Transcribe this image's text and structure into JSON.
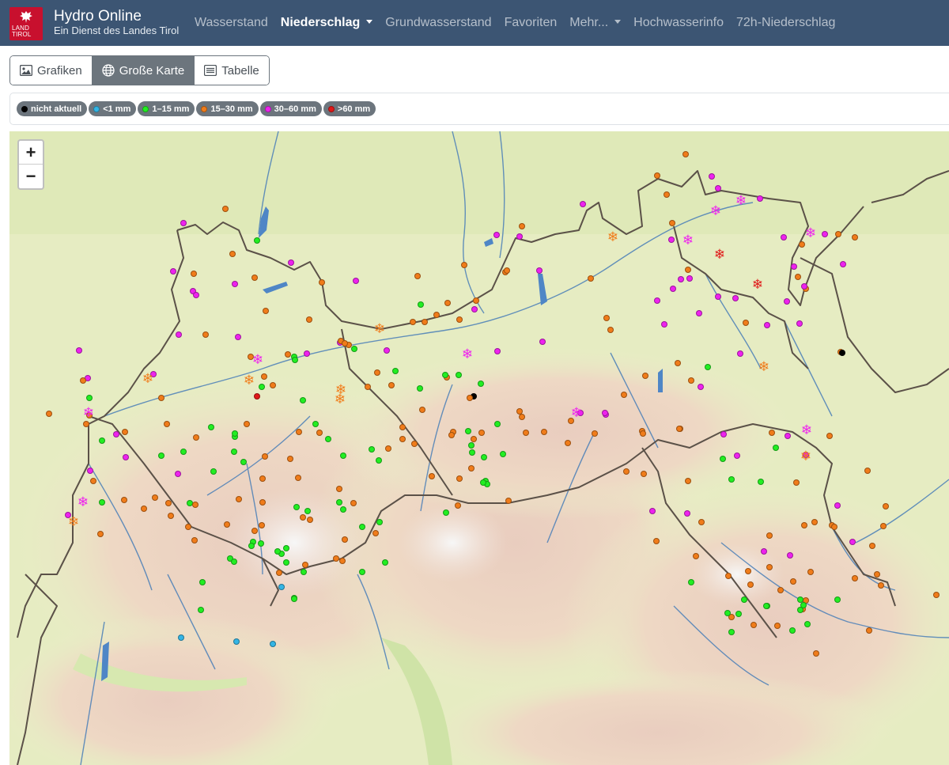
{
  "app": {
    "title": "Hydro Online",
    "subtitle": "Ein Dienst des Landes Tirol",
    "logo_text": "LAND\nTIROL"
  },
  "nav": [
    {
      "label": "Wasserstand",
      "active": false,
      "dropdown": false
    },
    {
      "label": "Niederschlag",
      "active": true,
      "dropdown": true
    },
    {
      "label": "Grundwasserstand",
      "active": false,
      "dropdown": false
    },
    {
      "label": "Favoriten",
      "active": false,
      "dropdown": false
    },
    {
      "label": "Mehr...",
      "active": false,
      "dropdown": true
    },
    {
      "label": "Hochwasserinfo",
      "active": false,
      "dropdown": false
    },
    {
      "label": "72h-Niederschlag",
      "active": false,
      "dropdown": false
    }
  ],
  "views": [
    {
      "label": "Grafiken",
      "icon": "image-icon",
      "active": false
    },
    {
      "label": "Große Karte",
      "icon": "globe-icon",
      "active": true
    },
    {
      "label": "Tabelle",
      "icon": "list-icon",
      "active": false
    }
  ],
  "legend": [
    {
      "key": "black",
      "label": "nicht aktuell",
      "color": "#000000"
    },
    {
      "key": "blue",
      "label": "<1 mm",
      "color": "#33b5e5"
    },
    {
      "key": "green",
      "label": "1–15 mm",
      "color": "#22ee22"
    },
    {
      "key": "orange",
      "label": "15–30 mm",
      "color": "#f07c1a"
    },
    {
      "key": "magenta",
      "label": "30–60 mm",
      "color": "#ee22ee"
    },
    {
      "key": "red",
      "label": ">60 mm",
      "color": "#e01818"
    }
  ],
  "zoom": {
    "in": "+",
    "out": "−"
  },
  "colors": {
    "navbar": "#3c5573",
    "logo": "#c8102e",
    "border_line": "#5b5148",
    "river": "#4a7fb8",
    "lake": "#4f86c6"
  }
}
